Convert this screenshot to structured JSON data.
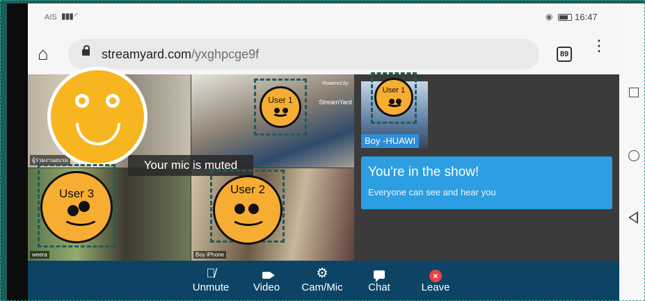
{
  "status_bar": {
    "carrier": "AIS",
    "time": "16:47"
  },
  "browser": {
    "url_domain": "streamyard.com",
    "url_path": "/yxghpcge9f",
    "tab_count": "89"
  },
  "participants": {
    "tile_1_name": "ผู้ร่วมงานอบรม",
    "tile_3_name": "weera",
    "tile_4_name": "Boy iPhone",
    "powered_by": "Powered by",
    "streamyard_logo": "StreamYard"
  },
  "toast": {
    "mic_muted": "Your mic is muted"
  },
  "self_view": {
    "name": "Boy -HUAWI"
  },
  "show_card": {
    "title": "You're in the show!",
    "subtitle": "Everyone can see and hear you"
  },
  "anonymization": {
    "user1_tile": "User 1",
    "user1_self": "User 1",
    "user2": "User 2",
    "user3": "User 3"
  },
  "toolbar": {
    "items": [
      {
        "label": "Unmute",
        "icon": "mic-off-icon"
      },
      {
        "label": "Video",
        "icon": "video-camera-icon"
      },
      {
        "label": "Cam/Mic",
        "icon": "gear-icon"
      },
      {
        "label": "Chat",
        "icon": "chat-icon"
      },
      {
        "label": "Leave",
        "icon": "close-circle-icon"
      }
    ]
  },
  "colors": {
    "toolbar_bg": "#0d4466",
    "show_card_bg": "#2c9ee1",
    "face_fill": "#f6ad32",
    "leave_red": "#e84444"
  }
}
